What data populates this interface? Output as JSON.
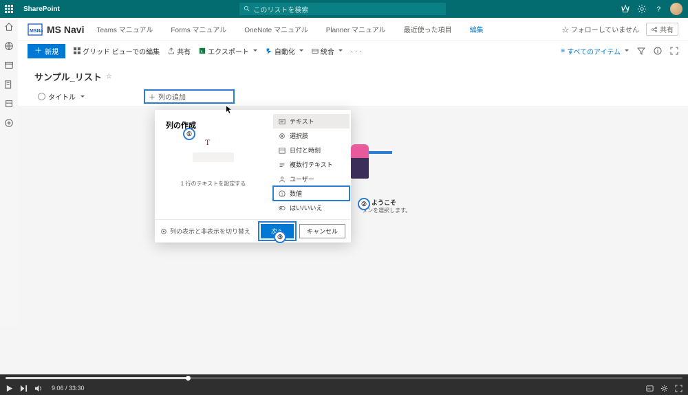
{
  "suite": {
    "appName": "SharePoint",
    "searchPlaceholder": "このリストを検索"
  },
  "site": {
    "logoText": "MSNavi",
    "title": "MS Navi",
    "nav": [
      "Teams マニュアル",
      "Forms マニュアル",
      "OneNote マニュアル",
      "Planner マニュアル",
      "最近使った項目"
    ],
    "edit": "編集",
    "follow": "☆ フォローしていません",
    "share": "共有"
  },
  "cmd": {
    "new": "新規",
    "grid": "グリッド ビューでの編集",
    "share": "共有",
    "export": "エクスポート",
    "automate": "自動化",
    "integrate": "統合",
    "allItems": "すべてのアイテム"
  },
  "list": {
    "title": "サンプル_リスト",
    "colTitle": "タイトル",
    "addColumn": "列の追加"
  },
  "panel": {
    "title": "列の作成",
    "caption": "1 行のテキストを設定する",
    "types": {
      "text": "テキスト",
      "choice": "選択肢",
      "date": "日付と時刻",
      "multiline": "複数行テキスト",
      "user": "ユーザー",
      "number": "数値",
      "yesno": "はい/いいえ"
    },
    "toggle": "列の表示と非表示を切り替え",
    "next": "次へ",
    "cancel": "キャンセル"
  },
  "callouts": {
    "one": "①",
    "two": "②",
    "three": "③"
  },
  "welcome": {
    "line1": "ようこそ",
    "line2": "タンを選択します。"
  },
  "video": {
    "time": "9:06 / 33:30"
  }
}
